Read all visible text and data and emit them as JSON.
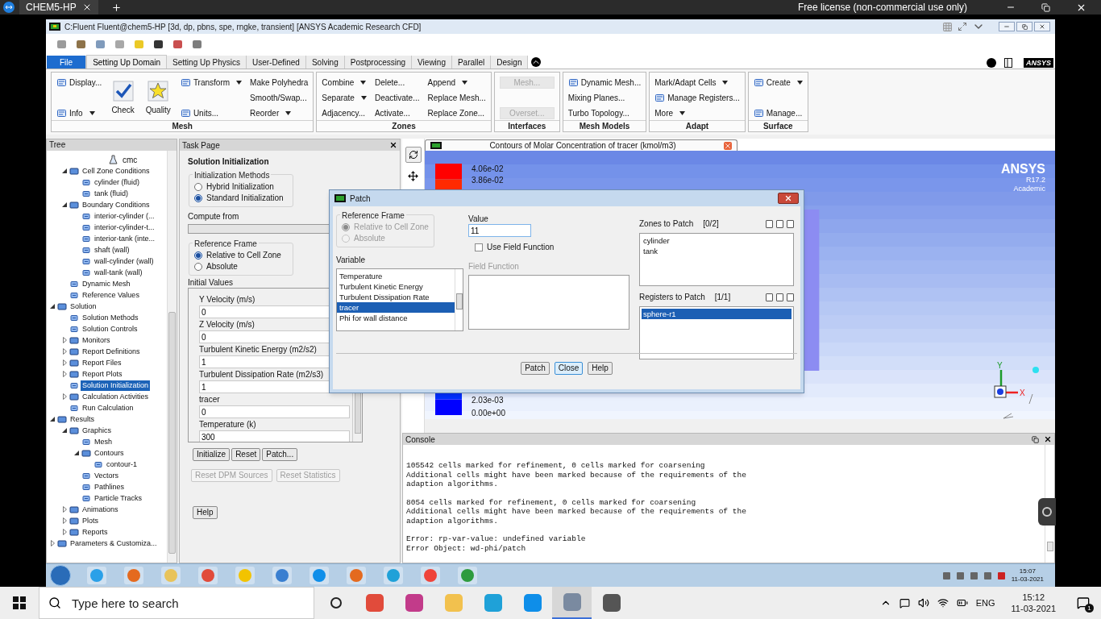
{
  "host_tab_bar": {
    "tab": "CHEM5-HP",
    "license": "Free license (non-commercial use only)"
  },
  "window": {
    "title": "C:Fluent Fluent@chem5-HP  [3d, dp, pbns, spe, rngke, transient] [ANSYS Academic Research CFD]"
  },
  "ribbon_tabs": [
    {
      "label": "File",
      "kind": "file",
      "selected": false
    },
    {
      "label": "Setting Up Domain",
      "kind": "tab",
      "selected": true
    },
    {
      "label": "Setting Up Physics",
      "kind": "tab",
      "selected": false
    },
    {
      "label": "User-Defined",
      "kind": "tab",
      "selected": false
    },
    {
      "label": "Solving",
      "kind": "tab",
      "selected": false
    },
    {
      "label": "Postprocessing",
      "kind": "tab",
      "selected": false
    },
    {
      "label": "Viewing",
      "kind": "tab",
      "selected": false
    },
    {
      "label": "Parallel",
      "kind": "tab",
      "selected": false
    },
    {
      "label": "Design",
      "kind": "tab",
      "selected": false
    }
  ],
  "ribbon_brand": "ANSYS",
  "ribbon_groups": [
    {
      "title": "Mesh",
      "columns": [
        [
          {
            "label": "Display...",
            "kind": "iconed",
            "menu": false
          },
          {
            "label": "Info",
            "kind": "iconed",
            "menu": true
          }
        ],
        [
          {
            "label": "Check",
            "kind": "tick",
            "menu": false
          }
        ],
        [
          {
            "label": "Quality",
            "kind": "star",
            "menu": false
          }
        ],
        [
          {
            "label": "Transform",
            "kind": "iconed",
            "menu": true
          },
          {
            "label": "Units...",
            "kind": "iconed",
            "menu": false
          }
        ],
        [
          {
            "label": "Make Polyhedra",
            "kind": "plain",
            "menu": false
          },
          {
            "label": "Smooth/Swap...",
            "kind": "plain",
            "menu": false
          },
          {
            "label": "Reorder",
            "kind": "plain",
            "menu": true
          }
        ]
      ]
    },
    {
      "title": "Zones",
      "columns": [
        [
          {
            "label": "Combine",
            "kind": "plain",
            "menu": true
          },
          {
            "label": "Separate",
            "kind": "plain",
            "menu": true
          },
          {
            "label": "Adjacency...",
            "kind": "plain",
            "menu": false
          }
        ],
        [
          {
            "label": "Delete...",
            "kind": "plain",
            "menu": false
          },
          {
            "label": "Deactivate...",
            "kind": "plain",
            "menu": false
          },
          {
            "label": "Activate...",
            "kind": "plain",
            "menu": false
          }
        ],
        [
          {
            "label": "Append",
            "kind": "plain",
            "menu": true
          },
          {
            "label": "Replace Mesh...",
            "kind": "plain",
            "menu": false
          },
          {
            "label": "Replace Zone...",
            "kind": "plain",
            "menu": false
          }
        ]
      ]
    },
    {
      "title": "Interfaces",
      "columns": [
        [
          {
            "label": "Mesh...",
            "kind": "greyed",
            "menu": false
          },
          {
            "label": "Overset...",
            "kind": "greyed",
            "menu": false
          }
        ]
      ]
    },
    {
      "title": "Mesh Models",
      "columns": [
        [
          {
            "label": "Dynamic Mesh...",
            "kind": "iconed",
            "menu": false
          },
          {
            "label": "Mixing Planes...",
            "kind": "plain",
            "menu": false
          },
          {
            "label": "Turbo Topology...",
            "kind": "plain",
            "menu": false
          }
        ]
      ]
    },
    {
      "title": "Adapt",
      "columns": [
        [
          {
            "label": "Mark/Adapt Cells",
            "kind": "plain",
            "menu": true
          },
          {
            "label": "Manage Registers...",
            "kind": "iconed",
            "menu": false
          },
          {
            "label": "More",
            "kind": "plain",
            "menu": true
          }
        ]
      ]
    },
    {
      "title": "Surface",
      "columns": [
        [
          {
            "label": "Create",
            "kind": "iconed",
            "menu": true
          },
          {
            "label": "Manage...",
            "kind": "iconed",
            "menu": false
          }
        ]
      ]
    }
  ],
  "tree": {
    "title": "Tree",
    "partial_top": {
      "label": "cmc"
    },
    "setup_items": [
      {
        "label": "Cell Zone Conditions",
        "kind": "folder",
        "expanded": true,
        "selected": false,
        "children": [
          {
            "label": "cylinder (fluid)",
            "kind": "leaf",
            "selected": false
          },
          {
            "label": "tank (fluid)",
            "kind": "leaf",
            "selected": false
          }
        ]
      },
      {
        "label": "Boundary Conditions",
        "kind": "folder",
        "expanded": true,
        "selected": false,
        "children": [
          {
            "label": "interior-cylinder (...",
            "kind": "leaf",
            "selected": false
          },
          {
            "label": "interior-cylinder-t...",
            "kind": "leaf",
            "selected": false
          },
          {
            "label": "interior-tank (inte...",
            "kind": "leaf",
            "selected": false
          },
          {
            "label": "shaft (wall)",
            "kind": "leaf",
            "selected": false
          },
          {
            "label": "wall-cylinder (wall)",
            "kind": "leaf",
            "selected": false
          },
          {
            "label": "wall-tank (wall)",
            "kind": "leaf",
            "selected": false
          }
        ]
      },
      {
        "label": "Dynamic Mesh",
        "kind": "leaf",
        "selected": false
      },
      {
        "label": "Reference Values",
        "kind": "leaf",
        "selected": false
      }
    ],
    "items": [
      {
        "label": "Solution",
        "kind": "folder",
        "expanded": true,
        "selected": false,
        "children": [
          {
            "label": "Solution Methods",
            "kind": "leaf",
            "selected": false
          },
          {
            "label": "Solution Controls",
            "kind": "leaf",
            "selected": false
          },
          {
            "label": "Monitors",
            "kind": "folder",
            "expanded": false,
            "selected": false
          },
          {
            "label": "Report Definitions",
            "kind": "folder",
            "expanded": false,
            "selected": false
          },
          {
            "label": "Report Files",
            "kind": "folder",
            "expanded": false,
            "selected": false
          },
          {
            "label": "Report Plots",
            "kind": "folder",
            "expanded": false,
            "selected": false
          },
          {
            "label": "Solution Initialization",
            "kind": "leaf",
            "selected": true
          },
          {
            "label": "Calculation Activities",
            "kind": "folder",
            "expanded": false,
            "selected": false
          },
          {
            "label": "Run Calculation",
            "kind": "leaf",
            "selected": false
          }
        ]
      },
      {
        "label": "Results",
        "kind": "folder",
        "expanded": true,
        "selected": false,
        "children": [
          {
            "label": "Graphics",
            "kind": "folder",
            "expanded": true,
            "selected": false,
            "children": [
              {
                "label": "Mesh",
                "kind": "leaf",
                "selected": false
              },
              {
                "label": "Contours",
                "kind": "folder",
                "expanded": true,
                "selected": false,
                "children": [
                  {
                    "label": "contour-1",
                    "kind": "leaf",
                    "selected": false
                  }
                ]
              },
              {
                "label": "Vectors",
                "kind": "leaf",
                "selected": false
              },
              {
                "label": "Pathlines",
                "kind": "leaf",
                "selected": false
              },
              {
                "label": "Particle Tracks",
                "kind": "leaf",
                "selected": false
              }
            ]
          },
          {
            "label": "Animations",
            "kind": "folder",
            "expanded": false,
            "selected": false
          },
          {
            "label": "Plots",
            "kind": "folder",
            "expanded": false,
            "selected": false
          },
          {
            "label": "Reports",
            "kind": "folder",
            "expanded": false,
            "selected": false
          }
        ]
      },
      {
        "label": "Parameters & Customiza...",
        "kind": "folder",
        "expanded": false,
        "selected": false
      }
    ]
  },
  "task_page": {
    "title": "Task Page",
    "heading": "Solution Initialization",
    "init_methods": {
      "title": "Initialization Methods",
      "options": [
        {
          "label": "Hybrid  Initialization",
          "selected": false
        },
        {
          "label": "Standard Initialization",
          "selected": true
        }
      ]
    },
    "compute_from": {
      "label": "Compute from"
    },
    "reference_frame": {
      "title": "Reference Frame",
      "options": [
        {
          "label": "Relative to Cell Zone",
          "selected": true
        },
        {
          "label": "Absolute",
          "selected": false
        }
      ]
    },
    "initial_values": {
      "title": "Initial Values",
      "fields": [
        {
          "label": "Y Velocity (m/s)",
          "value": "0"
        },
        {
          "label": "Z Velocity (m/s)",
          "value": "0"
        },
        {
          "label": "Turbulent Kinetic Energy (m2/s2)",
          "value": "1"
        },
        {
          "label": "Turbulent Dissipation Rate (m2/s3)",
          "value": "1"
        },
        {
          "label": "tracer",
          "value": "0"
        },
        {
          "label": "Temperature (k)",
          "value": "300"
        }
      ]
    },
    "buttons": [
      {
        "label": "Initialize",
        "disabled": false
      },
      {
        "label": "Reset",
        "disabled": false
      },
      {
        "label": "Patch...",
        "disabled": false
      }
    ],
    "secondary_buttons": [
      {
        "label": "Reset DPM Sources",
        "disabled": true
      },
      {
        "label": "Reset Statistics",
        "disabled": true
      }
    ],
    "help": "Help"
  },
  "graphics": {
    "tab_title": "Contours of Molar Concentration of tracer (kmol/m3)",
    "legend_top": [
      "4.06e-02",
      "3.86e-02"
    ],
    "legend_bottom": [
      "2.03e-03",
      "0.00e+00"
    ],
    "brand": {
      "name": "ANSYS",
      "version": "R17.2",
      "edition": "Academic"
    },
    "axes": {
      "y": "Y",
      "x": "X"
    }
  },
  "console": {
    "title": "Console",
    "blocks": [
      [
        "105542 cells marked for refinement, 0 cells marked for coarsening",
        "Additional cells might have been marked because of the requirements of the",
        "adaption algorithms."
      ],
      [
        "8054 cells marked for refinement, 0 cells marked for coarsening",
        "Additional cells might have been marked because of the requirements of the",
        "adaption algorithms."
      ],
      [
        "Error: rp-var-value: undefined variable",
        "Error Object: wd-phi/patch"
      ]
    ]
  },
  "patch_dialog": {
    "title": "Patch",
    "reference_frame": {
      "title": "Reference Frame",
      "disabled": true,
      "options": [
        {
          "label": "Relative to Cell Zone",
          "selected": true
        },
        {
          "label": "Absolute",
          "selected": false
        }
      ]
    },
    "variable": {
      "label": "Variable",
      "items": [
        {
          "label": "Temperature",
          "selected": false
        },
        {
          "label": "Turbulent Kinetic Energy",
          "selected": false
        },
        {
          "label": "Turbulent Dissipation Rate",
          "selected": false
        },
        {
          "label": "tracer",
          "selected": true
        },
        {
          "label": "Phi for wall distance",
          "selected": false
        }
      ]
    },
    "value": {
      "label": "Value",
      "value": "11"
    },
    "use_field_function": {
      "label": "Use Field Function",
      "checked": false
    },
    "field_function": {
      "label": "Field Function",
      "disabled": true
    },
    "zones": {
      "label": "Zones to Patch",
      "count": "[0/2]",
      "items": [
        {
          "label": "cylinder",
          "selected": false
        },
        {
          "label": "tank",
          "selected": false
        }
      ]
    },
    "registers": {
      "label": "Registers to Patch",
      "count": "[1/1]",
      "items": [
        {
          "label": "sphere-r1",
          "selected": true
        }
      ]
    },
    "buttons": [
      {
        "label": "Patch",
        "focused": false
      },
      {
        "label": "Close",
        "focused": true
      },
      {
        "label": "Help",
        "focused": false
      }
    ]
  },
  "remote_taskbar": {
    "time": "15:07",
    "date": "11-03-2021"
  },
  "host_taskbar": {
    "search_placeholder": "Type here to search",
    "apps": [
      {
        "selected": false
      },
      {
        "selected": false
      },
      {
        "selected": false
      },
      {
        "selected": false
      },
      {
        "selected": false
      },
      {
        "selected": true
      },
      {
        "selected": false
      }
    ],
    "language": "ENG",
    "time": "15:12",
    "date": "11-03-2021",
    "notifications": "1"
  }
}
